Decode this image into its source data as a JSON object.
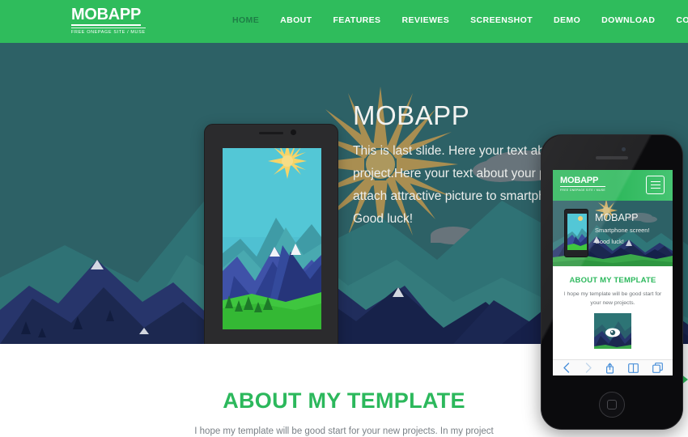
{
  "header": {
    "logo": {
      "main": "MOBAPP",
      "sub": "FREE ONEPAGE SITE / MUSE"
    },
    "nav": [
      {
        "label": "HOME",
        "active": true
      },
      {
        "label": "ABOUT",
        "active": false
      },
      {
        "label": "FEATURES",
        "active": false
      },
      {
        "label": "REVIEWES",
        "active": false
      },
      {
        "label": "SCREENSHOT",
        "active": false
      },
      {
        "label": "DEMO",
        "active": false
      },
      {
        "label": "DOWNLOAD",
        "active": false
      },
      {
        "label": "CONTACT",
        "active": false
      }
    ],
    "bg_color": "#2fbc5c",
    "active_color": "#1e7e46"
  },
  "hero": {
    "title": "MOBAPP",
    "paragraph": "This is last slide. Here your text about your project.Here your text about your project. Also attach attractive picture to smartphone screen! Good luck!",
    "bg_color": "#2d6166"
  },
  "phone_mockup": {
    "platform_icon": "windows-logo-icon",
    "screen_scene": "mountain-landscape-sun"
  },
  "device_preview": {
    "platform_icon": "iphone-home-button-icon",
    "site": {
      "logo": {
        "main": "MOBAPP",
        "sub": "FREE ONEPAGE SITE / MUSE"
      },
      "menu_icon": "hamburger-menu-icon",
      "hero": {
        "title": "MOBAPP",
        "line1": "Smartphone screen!",
        "line2": "Good luck!"
      },
      "about": {
        "title": "ABOUT MY TEMPLATE",
        "text": "I hope my template will be good start for your new projects."
      },
      "toolbar": [
        {
          "icon": "back-chevron-icon",
          "enabled": true
        },
        {
          "icon": "forward-chevron-icon",
          "enabled": false
        },
        {
          "icon": "share-icon",
          "enabled": true
        },
        {
          "icon": "bookmarks-icon",
          "enabled": true
        },
        {
          "icon": "tabs-icon",
          "enabled": true
        }
      ]
    }
  },
  "about_section": {
    "title": "ABOUT MY TEMPLATE",
    "subtitle": "I hope my template will be good start for your new projects. In my project",
    "title_color": "#2cb85c"
  }
}
